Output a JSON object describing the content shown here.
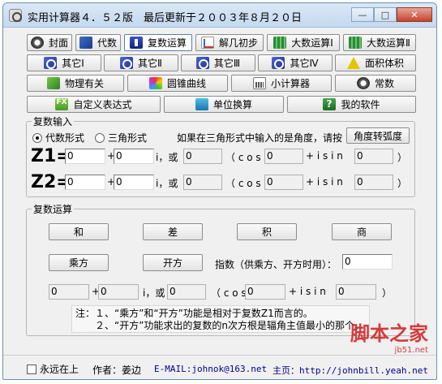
{
  "window": {
    "title": "实用计算器４．５２版　最后更新于２００３年８月２０日",
    "minimize": "—",
    "maximize": "□",
    "close": "✕"
  },
  "nav": {
    "row1": [
      "封面",
      "代数",
      "复数运算",
      "解几初步",
      "大数运算Ⅰ",
      "大数运算Ⅱ"
    ],
    "row2": [
      "其它Ⅰ",
      "其它Ⅱ",
      "其它Ⅲ",
      "其它Ⅳ",
      "面积体积"
    ],
    "row3": [
      "物理有关",
      "圆锥曲线",
      "小计算器",
      "常数"
    ],
    "row4": [
      "自定义表达式",
      "单位换算",
      "我的软件"
    ],
    "active": "复数运算"
  },
  "input_group": {
    "legend": "复数输入",
    "radio_algebraic": "代数形式",
    "radio_trig": "三角形式",
    "selected_form": "代数形式",
    "hint": "如果在三角形式中输入的是角度，请按",
    "angle_button": "角度转弧度",
    "z1_label": "Z1=",
    "z2_label": "Z2=",
    "z1": {
      "real": "0",
      "imag": "0",
      "r": "0",
      "cos_arg": "0",
      "sin_arg": "0"
    },
    "z2": {
      "real": "0",
      "imag": "0",
      "r": "0",
      "cos_arg": "0",
      "sin_arg": "0"
    },
    "plus": "+",
    "i_or": "i，或",
    "cos_open": "（ c o s",
    "plus_isin": "+ i s i n",
    "close_paren": "）"
  },
  "ops_group": {
    "legend": "复数运算",
    "ops": [
      "和",
      "差",
      "积",
      "商"
    ],
    "power_button": "乘方",
    "root_button": "开方",
    "exponent_label": "指数（供乘方、开方时用）：",
    "exponent_value": "0",
    "result": {
      "real": "0",
      "imag": "0",
      "r": "0",
      "cos_arg": "0",
      "sin_arg": "0"
    },
    "result_cos_open": "（ c o s",
    "note_line1": "注：１、“乘方”和“开方”功能是相对于复数Z1而言的。",
    "note_line2": "　　２、“开方”功能求出的复数的n次方根是辐角主值最小的那个。"
  },
  "watermark": {
    "text": "脚本之家",
    "url": "jb51.net"
  },
  "footer": {
    "topmost_label": "永远在上",
    "author_label": "作者：姜边",
    "email_label": "E-MAIL:johnok@163.net",
    "home_label": "主页：http://johnbill.yeah.net"
  }
}
